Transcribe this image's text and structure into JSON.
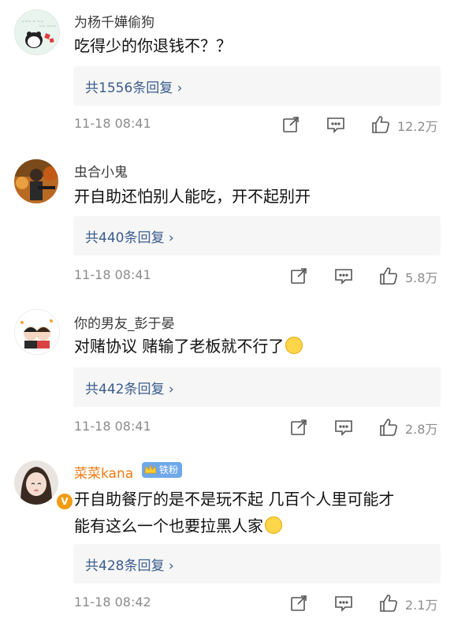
{
  "icons": {
    "share": "share-icon",
    "comment": "comment-icon",
    "like": "like-icon"
  },
  "colors": {
    "reply_link": "#3b5c8d",
    "vip_name": "#f07a12",
    "reply_bg": "#f6f6f6",
    "meta": "#8c8c8c"
  },
  "comments": [
    {
      "username": "为杨千嬅偷狗",
      "text": "吃得少的你退钱不？？",
      "replies": "共1556条回复",
      "time": "11-18 08:41",
      "likes": "12.2万"
    },
    {
      "username": "虫合小鬼",
      "text": "开自助还怕别人能吃，开不起别开",
      "replies": "共440条回复",
      "time": "11-18 08:41",
      "likes": "5.8万"
    },
    {
      "username": "你的男友_彭于晏",
      "text": "对赌协议 赌输了老板就不行了",
      "replies": "共442条回复",
      "time": "11-18 08:41",
      "likes": "2.8万"
    },
    {
      "username": "菜菜kana",
      "badge": "铁粉",
      "text_line1": "开自助餐厅的是不是玩不起 几百个人里可能才",
      "text_line2": "能有这么一个也要拉黑人家",
      "replies": "共428条回复",
      "time": "11-18 08:42",
      "likes": "2.1万"
    }
  ]
}
